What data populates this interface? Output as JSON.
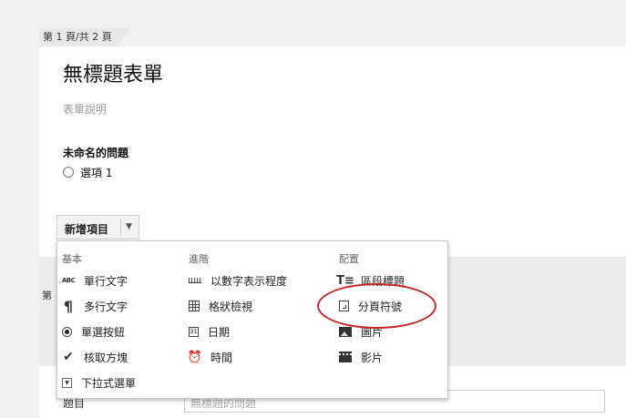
{
  "page_tab": "第 1 頁/共 2 頁",
  "form": {
    "title": "無標題表單",
    "description": "表單說明",
    "question_title": "未命名的問題",
    "option_label": "選項 1"
  },
  "add_button": {
    "label": "新增項目"
  },
  "lower": {
    "page_tab_fragment": "第",
    "field_label": "題目",
    "field_placeholder": "無標題的問題"
  },
  "menu": {
    "basic": {
      "heading": "基本",
      "items": [
        {
          "label": "單行文字",
          "icon": "text-abc-icon"
        },
        {
          "label": "多行文字",
          "icon": "paragraph-icon"
        },
        {
          "label": "單選按鈕",
          "icon": "radio-icon"
        },
        {
          "label": "核取方塊",
          "icon": "checkbox-icon"
        },
        {
          "label": "下拉式選單",
          "icon": "dropdown-icon"
        }
      ]
    },
    "advanced": {
      "heading": "進階",
      "items": [
        {
          "label": "以數字表示程度",
          "icon": "scale-icon"
        },
        {
          "label": "格狀檢視",
          "icon": "grid-icon"
        },
        {
          "label": "日期",
          "icon": "calendar-icon"
        },
        {
          "label": "時間",
          "icon": "clock-icon"
        }
      ]
    },
    "layout": {
      "heading": "配置",
      "items": [
        {
          "label": "區段標題",
          "icon": "section-header-icon"
        },
        {
          "label": "分頁符號",
          "icon": "page-break-icon"
        },
        {
          "label": "圖片",
          "icon": "image-icon"
        },
        {
          "label": "影片",
          "icon": "video-icon"
        }
      ]
    }
  },
  "colors": {
    "highlight_ellipse": "#c22828",
    "page_background": "#f1f1f1"
  }
}
